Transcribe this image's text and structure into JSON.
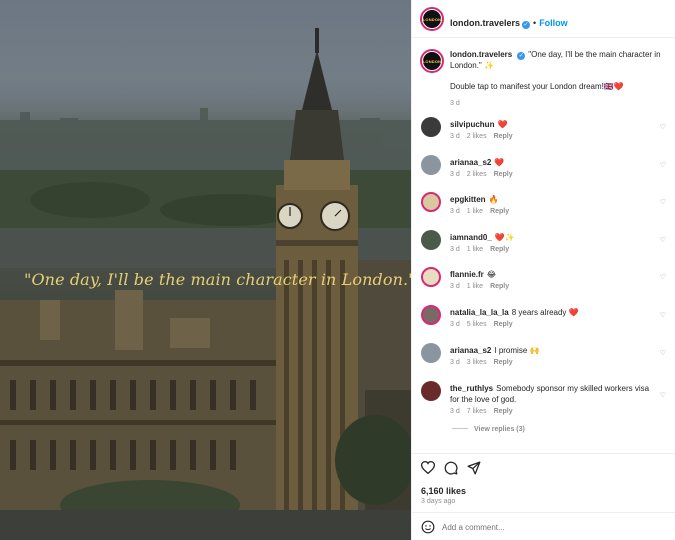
{
  "photo": {
    "quote": "\"One day, I'll be the main character in London.\""
  },
  "account": {
    "logo_text": "LONDON",
    "username": "london.travelers",
    "follow_label": "Follow",
    "separator": "•"
  },
  "caption": {
    "username": "london.travelers",
    "text": "\"One day, I'll be the main character in London.\" ✨",
    "line2": "Double tap to manifest your London dream!🇬🇧❤️",
    "time": "3 d"
  },
  "comments": [
    {
      "username": "silvipuchun",
      "text": "❤️",
      "time": "3 d",
      "likes": "2 likes",
      "reply": "Reply",
      "avatar_color": "#3a3a3a"
    },
    {
      "username": "arianaa_s2",
      "text": "❤️",
      "time": "3 d",
      "likes": "2 likes",
      "reply": "Reply",
      "avatar_color": "#8a95a0"
    },
    {
      "username": "epgkitten",
      "text": "🔥",
      "time": "3 d",
      "likes": "1 like",
      "reply": "Reply",
      "avatar_color": "#d9c7a0"
    },
    {
      "username": "iamnand0_",
      "text": "❤️✨",
      "time": "3 d",
      "likes": "1 like",
      "reply": "Reply",
      "avatar_color": "#4b5a4a"
    },
    {
      "username": "flannie.fr",
      "text": "😂",
      "time": "3 d",
      "likes": "1 like",
      "reply": "Reply",
      "avatar_color": "#e8dcc0"
    },
    {
      "username": "natalia_la_la_la",
      "text": "8 years already ❤️",
      "time": "3 d",
      "likes": "5 likes",
      "reply": "Reply",
      "avatar_color": "#7a6a66"
    },
    {
      "username": "arianaa_s2",
      "text": "I promise 🙌",
      "time": "3 d",
      "likes": "3 likes",
      "reply": "Reply",
      "avatar_color": "#8a95a0"
    },
    {
      "username": "the_ruthlys",
      "text": "Somebody sponsor my skilled workers visa for the love of god.",
      "time": "3 d",
      "likes": "7 likes",
      "reply": "Reply",
      "avatar_color": "#6b2a2a"
    }
  ],
  "view_replies": "View replies (3)",
  "post": {
    "likes": "6,160 likes",
    "date": "3 days ago",
    "add_comment_placeholder": "Add a comment..."
  },
  "icons": {
    "like": "heart-outline-icon",
    "comment": "comment-bubble-icon",
    "share": "paper-plane-icon",
    "emoji": "smiley-icon",
    "verified": "verified-badge-icon"
  },
  "colors": {
    "follow": "#0095f6",
    "verified": "#3897f0",
    "quote": "#e8cf74",
    "heart": "#ed4956"
  }
}
